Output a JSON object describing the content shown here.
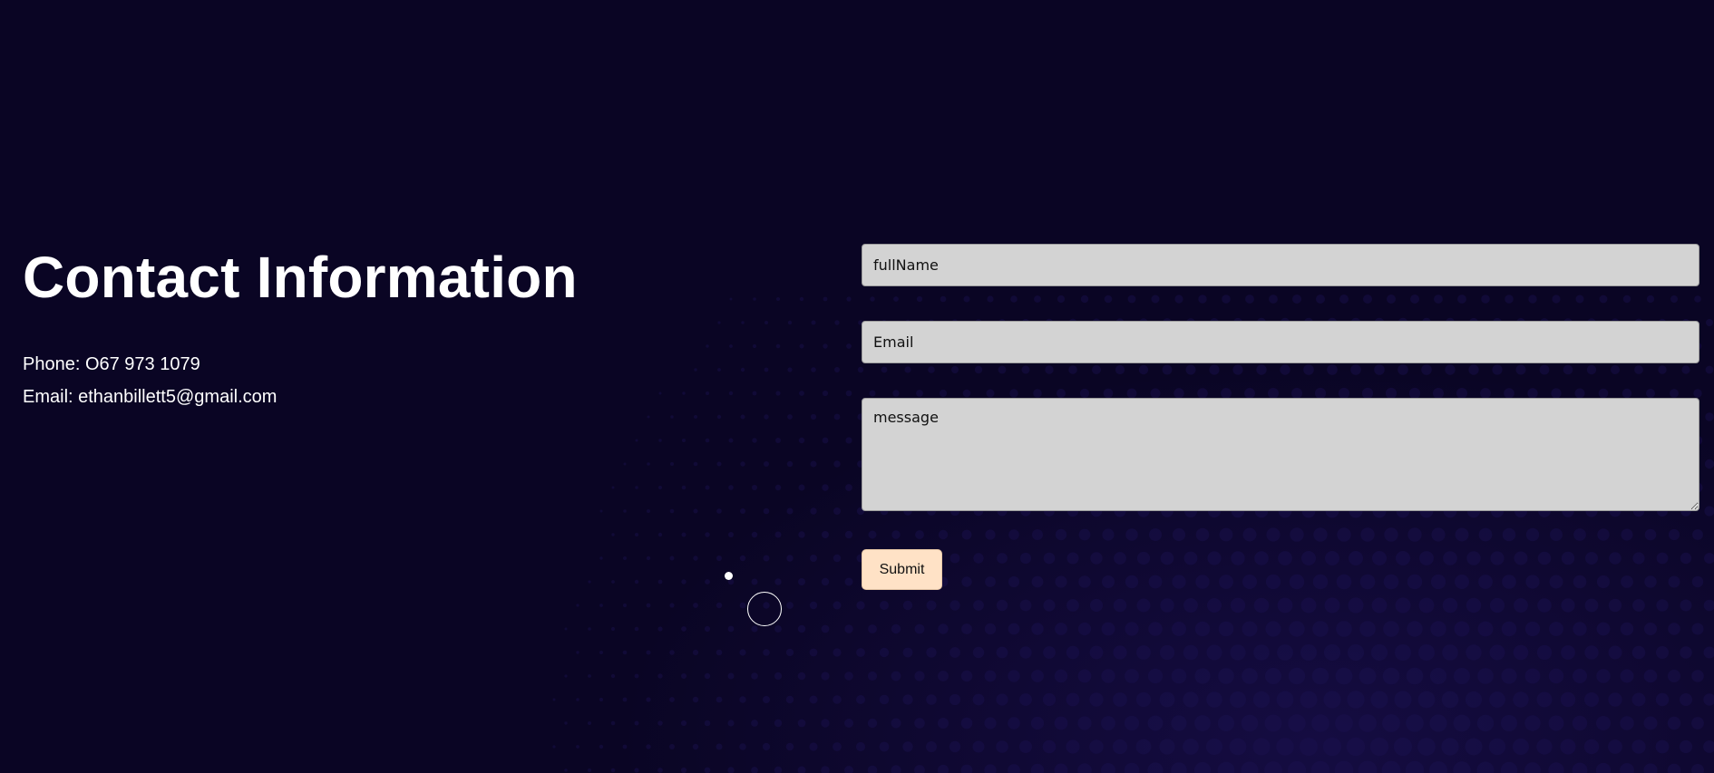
{
  "contact": {
    "title": "Contact Information",
    "phone": "Phone: O67 973 1079",
    "email": "Email: ethanbillett5@gmail.com"
  },
  "form": {
    "full_name_placeholder": "fullName",
    "email_placeholder": "Email",
    "message_placeholder": "message",
    "submit_label": "Submit"
  },
  "colors": {
    "background": "#0a0524",
    "input_background": "#d3d3d3",
    "submit_background": "#ffe2c6",
    "text": "#ffffff"
  }
}
